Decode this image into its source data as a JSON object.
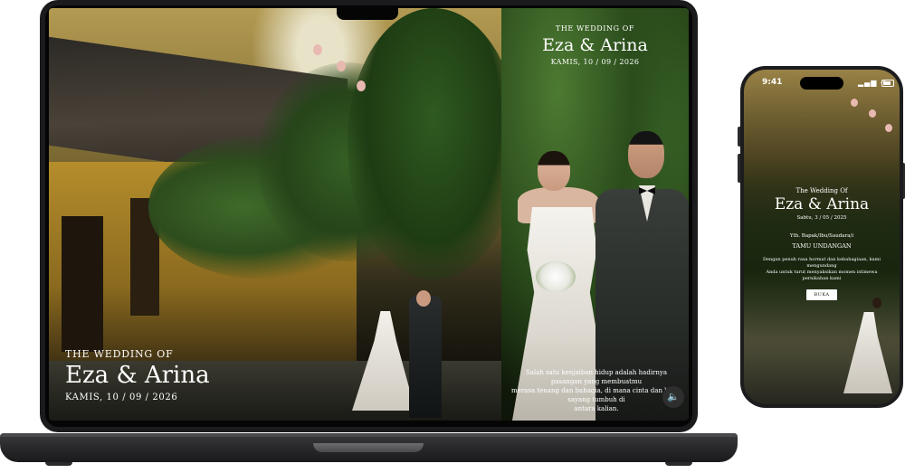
{
  "laptop": {
    "left_panel": {
      "kicker": "THE WEDDING OF",
      "names": "Eza & Arina",
      "date": "KAMIS, 10 / 09 / 2026"
    },
    "right_panel": {
      "kicker": "THE WEDDING OF",
      "names": "Eza & Arina",
      "date": "KAMIS, 10 / 09 / 2026",
      "paragraph": [
        "Salah satu kenjaiban hidup adalah hadirnya pasangan yang membuatmu",
        "merasa tenang dan bahagia, di mana cinta dan kasih sayang tumbuh di",
        "antara kalian."
      ],
      "sound_icon": "speaker-icon",
      "sound_glyph": "🔈"
    }
  },
  "phone": {
    "status_bar": {
      "time": "9:41",
      "indicators": "▂▄▆ ◠"
    },
    "kicker": "The Wedding Of",
    "names": "Eza & Arina",
    "date": "Sabtu, 3 / 05 / 2025",
    "greeting": "Yth. Bapak/Ibu/Saudara/i",
    "guest_label": "TAMU UNDANGAN",
    "message": [
      "Dengan penuh rasa hormat dan kebahagiaan, kami mengundang",
      "Anda untuk turut menyaksikan momen istimewa pernikahan kami"
    ],
    "open_button": "BUKA"
  },
  "colors": {
    "laptop_body": "#1b1b1d",
    "text_light": "#ffffff",
    "button_bg": "#ffffff"
  }
}
